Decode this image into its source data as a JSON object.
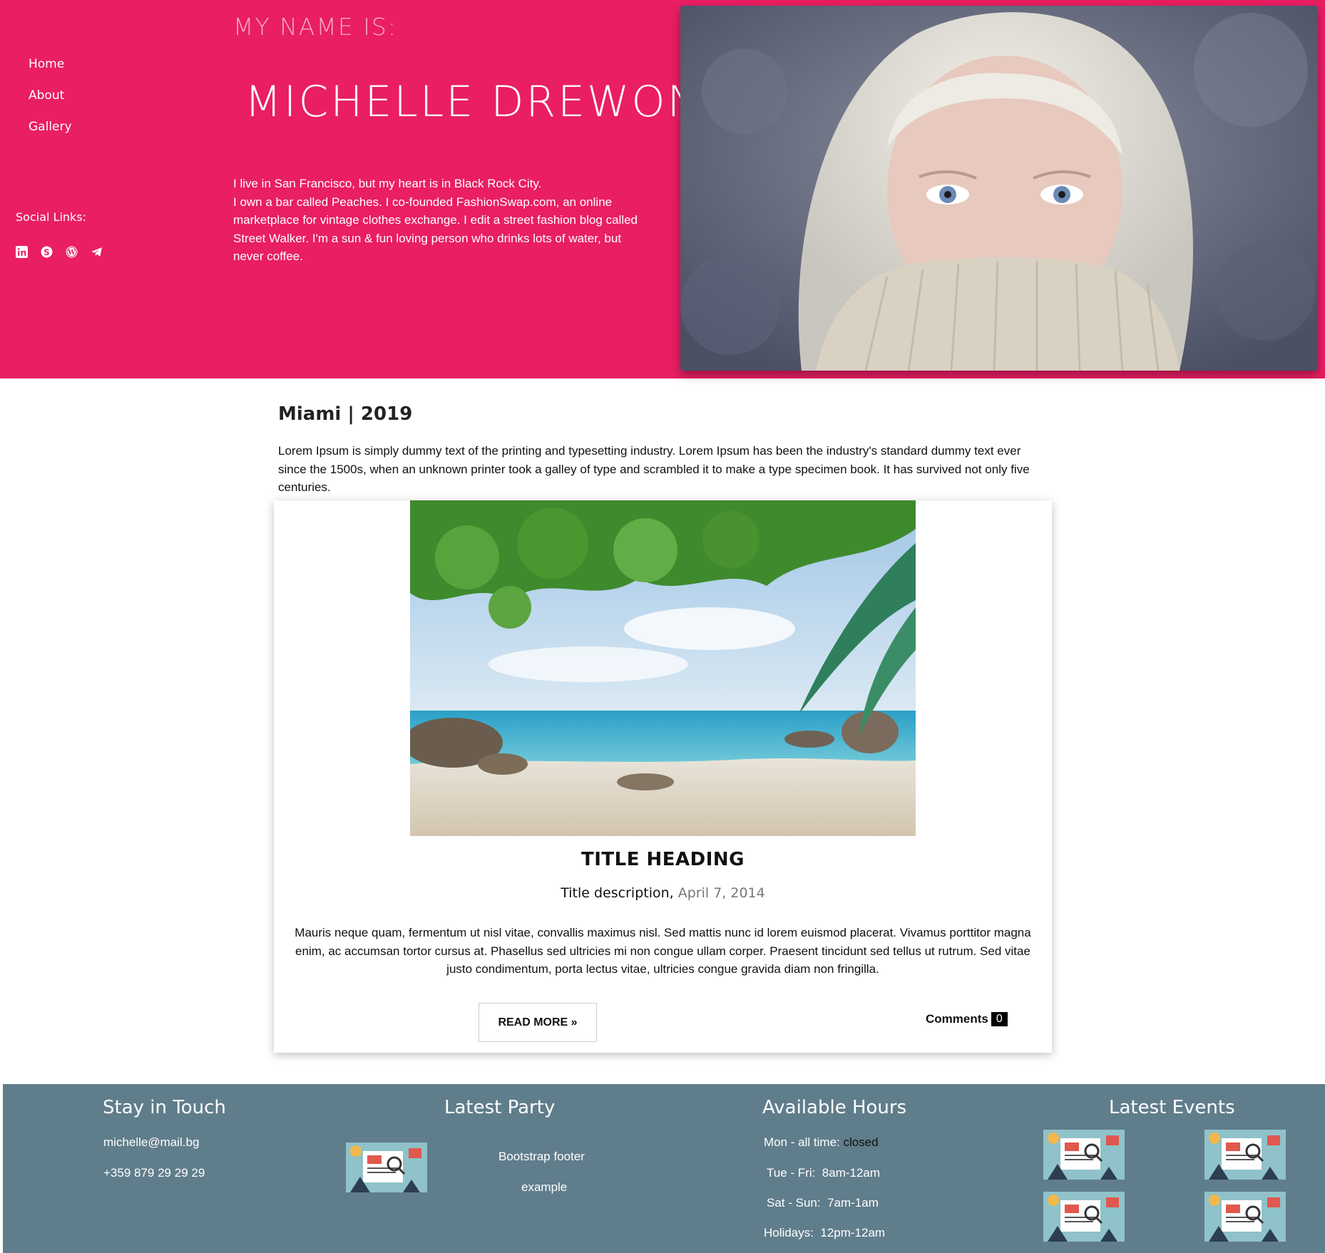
{
  "nav": {
    "items": [
      {
        "label": "Home"
      },
      {
        "label": "About"
      },
      {
        "label": "Gallery"
      }
    ]
  },
  "social": {
    "title": "Social Links:",
    "icons": [
      "linkedin-icon",
      "skype-icon",
      "wordpress-icon",
      "telegram-icon"
    ]
  },
  "hero": {
    "intro_label": "MY NAME IS:",
    "name": "MICHELLE DREWON",
    "bio_line1": "I live in San Francisco, but my heart is in Black Rock City.",
    "bio_line2": "I own a bar called Peaches. I co-founded FashionSwap.com, an online marketplace for vintage clothes exchange. I edit a street fashion blog called Street Walker. I'm a sun & fun loving person who drinks lots of water, but never coffee."
  },
  "post": {
    "place": "Miami | 2019",
    "intro": "Lorem Ipsum is simply dummy text of the printing and typesetting industry. Lorem Ipsum has been the industry's standard dummy text ever since the 1500s, when an unknown printer took a galley of type and scrambled it to make a type specimen book. It has survived not only five centuries.",
    "card": {
      "title": "TITLE HEADING",
      "subtitle": "Title description,",
      "date": "April 7, 2014",
      "body": "Mauris neque quam, fermentum ut nisl vitae, convallis maximus nisl. Sed mattis nunc id lorem euismod placerat. Vivamus porttitor magna enim, ac accumsan tortor cursus at. Phasellus sed ultricies mi non congue ullam corper. Praesent tincidunt sed tellus ut rutrum. Sed vitae justo condimentum, porta lectus vitae, ultricies congue gravida diam non fringilla.",
      "read_more": "READ MORE »",
      "comments_label": "Comments",
      "comments_count": "0"
    }
  },
  "footer": {
    "stay": {
      "title": "Stay in Touch",
      "email": "michelle@mail.bg",
      "phone": "+359 879 29 29 29"
    },
    "party": {
      "title": "Latest Party",
      "line1": "Bootstrap footer",
      "line2": "example"
    },
    "hours": {
      "title": "Available Hours",
      "rows": [
        {
          "label": "Mon - all time:",
          "value": "closed"
        },
        {
          "label": "Tue - Fri:",
          "value": "8am-12am"
        },
        {
          "label": "Sat - Sun:",
          "value": "7am-1am"
        },
        {
          "label": "Holidays:",
          "value": "12pm-12am"
        }
      ]
    },
    "events": {
      "title": "Latest Events"
    }
  },
  "colors": {
    "brand_pink": "#e91e63",
    "footer_bg": "#607d8b"
  }
}
